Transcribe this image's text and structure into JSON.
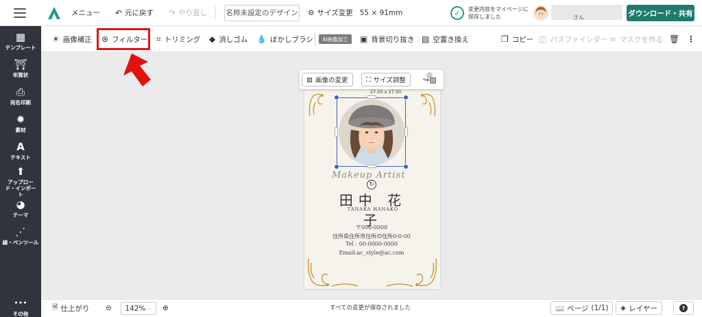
{
  "header": {
    "menu_label": "メニュー",
    "undo_label": "元に戻す",
    "redo_label": "やり直し",
    "design_name": "名称未設定のデザイン",
    "size_change_label": "サイズ変更",
    "size_dims": "55 × 91mm",
    "save_status": "変更内容をマイページに保存しました",
    "username_suffix": "さん",
    "download_label": "ダウンロード・共有"
  },
  "sidebar": {
    "items": [
      {
        "label": "テンプレート",
        "icon": "template-icon"
      },
      {
        "label": "年賀状",
        "icon": "new-year-icon"
      },
      {
        "label": "宛名印刷",
        "icon": "printer-icon"
      },
      {
        "label": "素材",
        "icon": "gear-icon"
      },
      {
        "label": "テキスト",
        "icon": "text-icon"
      },
      {
        "label": "アップロード・インポート",
        "icon": "upload-icon"
      },
      {
        "label": "テーマ",
        "icon": "palette-icon"
      },
      {
        "label": "線・ペンツール",
        "icon": "pen-icon"
      },
      {
        "label": "その他",
        "icon": "more-icon"
      }
    ]
  },
  "toolbar": {
    "image_correction": "画像補正",
    "filter": "フィルター",
    "trimming": "トリミング",
    "eraser": "消しゴム",
    "blur_brush": "ぼかしブラシ",
    "ai_badge": "AI画像加工",
    "bg_removal": "背景切り抜き",
    "sky_replace": "空置き換え",
    "copy": "コピー",
    "pathfinder": "パスファインダー",
    "mask": "マスクを作る"
  },
  "float_bar": {
    "change_image": "画像の変更",
    "resize": "サイズ調整"
  },
  "card": {
    "dims_label": "27.50 x 27.50",
    "subtitle": "Makeup Artist",
    "name_jp": "田中 花子",
    "name_en": "TANAKA HANAKO",
    "postal": "〒000-0000",
    "address": "住所県住所市住所の住所0-0-00",
    "tel": "Tel : 00-0000-0000",
    "email": "Email:ac_style@ac.com"
  },
  "bottom": {
    "finish": "仕上がり",
    "zoom": "142%",
    "saved_message": "すべての変更が保存されました",
    "page_label": "ページ",
    "page_count": "(1/1)",
    "layer_label": "レイヤー"
  },
  "colors": {
    "accent": "#1f7a6e",
    "sidebar_bg": "#30343c",
    "highlight": "#e11515",
    "selection": "#3b5fc0"
  }
}
